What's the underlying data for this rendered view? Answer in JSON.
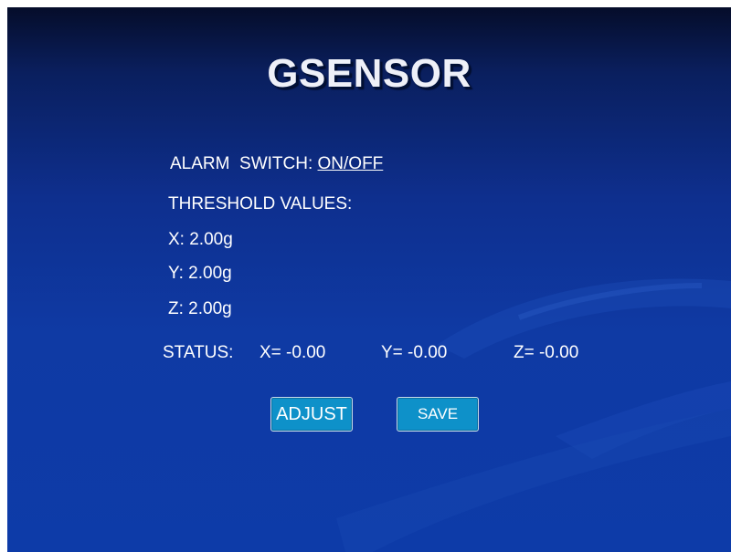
{
  "title": "GSENSOR",
  "alarm": {
    "label": "ALARM  SWITCH:",
    "value": "ON/OFF"
  },
  "threshold": {
    "label": "THRESHOLD VALUES:",
    "x": "X: 2.00g",
    "y": "Y: 2.00g",
    "z": "Z: 2.00g"
  },
  "status": {
    "label": "STATUS:",
    "x": "X= -0.00",
    "y": "Y= -0.00",
    "z": "Z= -0.00"
  },
  "buttons": {
    "adjust": "ADJUST",
    "save": "SAVE"
  },
  "colors": {
    "background": "#0f3aa4",
    "button": "#0e91c9",
    "text": "#ffffff"
  }
}
